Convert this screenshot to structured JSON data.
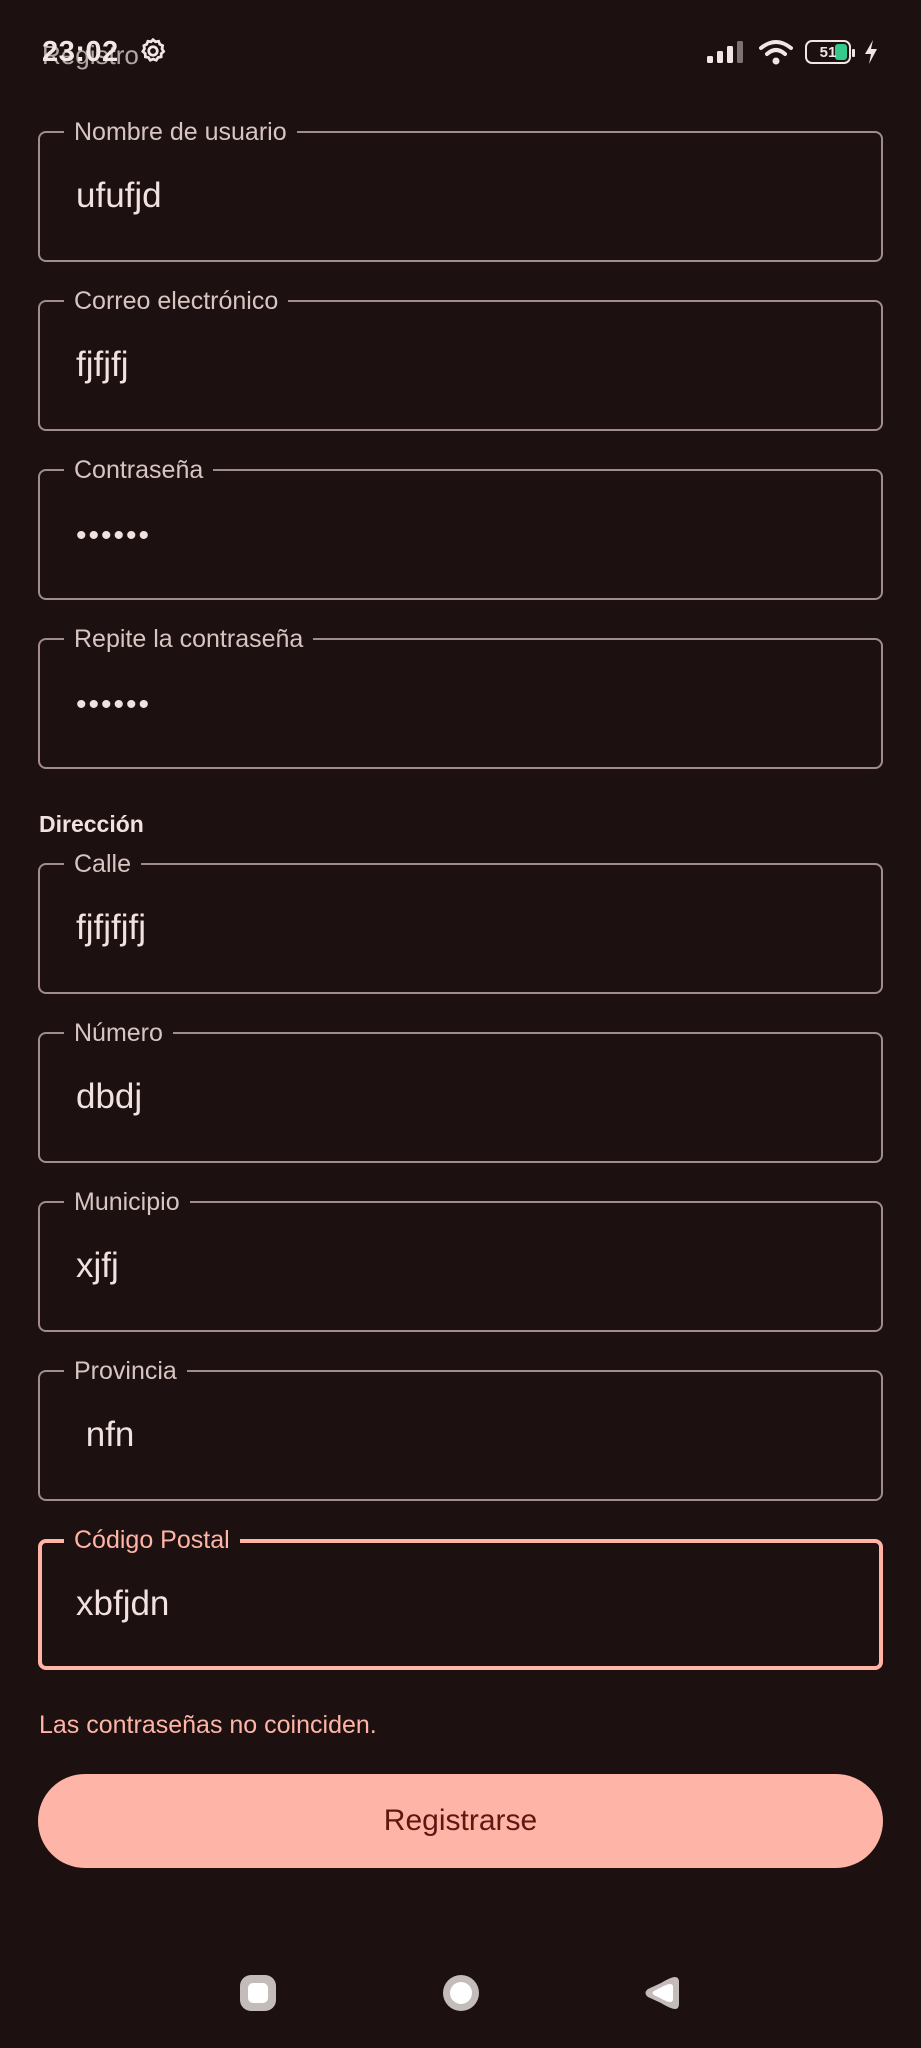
{
  "status_bar": {
    "time": "23:02",
    "title": "Registro",
    "battery": "51",
    "icons": [
      "settings-icon",
      "signal-icon",
      "wifi-icon",
      "battery-icon",
      "charging-icon"
    ]
  },
  "form": {
    "fields": [
      {
        "label": "Nombre de usuario",
        "value": "ufufjd"
      },
      {
        "label": "Correo electrónico",
        "value": "fjfjfj"
      },
      {
        "label": "Contraseña",
        "value": "••••••"
      },
      {
        "label": "Repite la contraseña",
        "value": "••••••"
      },
      {
        "label": "Calle",
        "value": "fjfjfjfj"
      },
      {
        "label": "Número",
        "value": "dbdj"
      },
      {
        "label": "Municipio",
        "value": "xjfj"
      },
      {
        "label": "Provincia",
        "value": " nfn"
      },
      {
        "label": "Código Postal",
        "value": "xbfjdn"
      }
    ],
    "section_title": "Dirección",
    "error": "Las contraseñas no coinciden.",
    "submit_label": "Registrarse"
  },
  "nav_bar": {
    "icons": [
      "recents-icon",
      "home-icon",
      "back-icon"
    ]
  },
  "colors": {
    "background": "#1d1010",
    "accent": "#ffb4a8",
    "outline": "#a08c8a",
    "button_text": "#5e1810"
  }
}
